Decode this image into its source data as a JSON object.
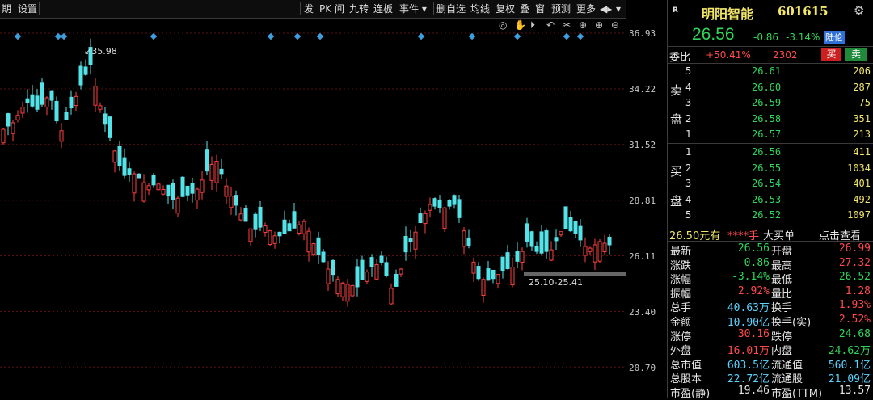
{
  "toolbar": {
    "left_items": [
      "期",
      "设置"
    ],
    "right_items": [
      "发",
      "PK",
      "间",
      "九转",
      "连板",
      "事件 ▾",
      "删自选",
      "均线",
      "复权",
      "叠",
      "窗",
      "预测",
      "更多"
    ],
    "arrow": "◀▸",
    "caret": "▾"
  },
  "chart": {
    "y_axis_labels": [
      "36.93",
      "34.22",
      "31.52",
      "28.81",
      "26.11",
      "23.40",
      "20.70"
    ],
    "high_marker": "35.98",
    "range_label": "25.10-25.41",
    "controls": [
      "◎",
      "✋",
      "⏵",
      "↶",
      "✂",
      "⊕",
      "⊕",
      "⊖"
    ],
    "colors": {
      "up": "#ff4040",
      "down": "#54e3e8",
      "grid": "#5a1010",
      "marker": "#3ca0e0"
    }
  },
  "panel": {
    "badge": "R",
    "name": "明阳智能",
    "code": "601615",
    "price": "26.56",
    "change": "-0.86",
    "change_pct": "-3.14%",
    "tag": "陆伦",
    "ratio_label": "委比",
    "ratio_value": "+50.41%",
    "ratio_diff": "2302",
    "buy_btn": "买",
    "sell_btn": "卖",
    "sell_label": [
      "卖",
      "盘"
    ],
    "buy_label": [
      "买",
      "盘"
    ],
    "sell_levels": [
      {
        "n": "5",
        "price": "26.61",
        "vol": "206"
      },
      {
        "n": "4",
        "price": "26.60",
        "vol": "287"
      },
      {
        "n": "3",
        "price": "26.59",
        "vol": "75"
      },
      {
        "n": "2",
        "price": "26.58",
        "vol": "351"
      },
      {
        "n": "1",
        "price": "26.57",
        "vol": "213"
      }
    ],
    "buy_levels": [
      {
        "n": "1",
        "price": "26.56",
        "vol": "411"
      },
      {
        "n": "2",
        "price": "26.55",
        "vol": "1034"
      },
      {
        "n": "3",
        "price": "26.54",
        "vol": "401"
      },
      {
        "n": "4",
        "price": "26.53",
        "vol": "492"
      },
      {
        "n": "5",
        "price": "26.52",
        "vol": "1097"
      }
    ],
    "bigorder": {
      "price": "26.50元有",
      "stars": "****手",
      "label": "大买单",
      "link": "点击查看"
    },
    "stats": [
      {
        "l1": "最新",
        "v1": "26.56",
        "l2": "开盘",
        "v2": "26.99"
      },
      {
        "l1": "涨跌",
        "v1": "-0.86",
        "l2": "最高",
        "v2": "27.32"
      },
      {
        "l1": "涨幅",
        "v1": "-3.14%",
        "l2": "最低",
        "v2": "26.52"
      },
      {
        "l1": "振幅",
        "v1": "2.92%",
        "l2": "量比",
        "v2": "1.28"
      },
      {
        "l1": "总手",
        "v1": "40.63万",
        "l2": "换手",
        "v2": "1.93%"
      },
      {
        "l1": "金额",
        "v1": "10.90亿",
        "l2": "换手(实)",
        "v2": "2.52%"
      },
      {
        "l1": "涨停",
        "v1": "30.16",
        "l2": "跌停",
        "v2": "24.68"
      },
      {
        "l1": "外盘",
        "v1": "16.01万",
        "l2": "内盘",
        "v2": "24.62万"
      },
      {
        "l1": "总市值",
        "v1": "603.5亿",
        "l2": "流通值",
        "v2": "560.1亿"
      },
      {
        "l1": "总股本",
        "v1": "22.72亿",
        "l2": "流通股",
        "v2": "21.09亿"
      },
      {
        "l1": "市盈(静)",
        "v1": "19.46",
        "l2": "市盈(TTM)",
        "v2": "13.57"
      }
    ]
  }
}
